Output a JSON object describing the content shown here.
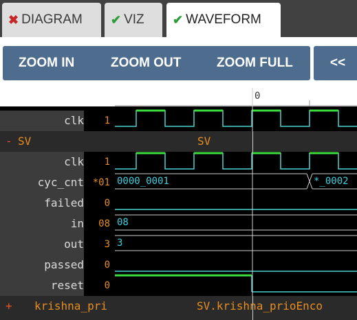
{
  "tabs": [
    {
      "label": "DIAGRAM",
      "icon": "x-icon",
      "glyph": "✖",
      "active": false
    },
    {
      "label": "VIZ",
      "icon": "check-icon",
      "glyph": "✔",
      "active": false
    },
    {
      "label": "WAVEFORM",
      "icon": "check-icon",
      "glyph": "✔",
      "active": true
    }
  ],
  "toolbar": {
    "zoom_in": "ZOOM IN",
    "zoom_out": "ZOOM OUT",
    "zoom_full": "ZOOM FULL",
    "prev": "<<"
  },
  "ruler": {
    "marker_label": "0"
  },
  "signals": {
    "top_clk": {
      "name": "clk",
      "value": "1"
    },
    "group_sv": {
      "sign": "-",
      "name": "SV",
      "center_label": "SV"
    },
    "clk": {
      "name": "clk",
      "value": "1"
    },
    "cyc_cnt": {
      "name": "cyc_cnt",
      "value": "*01",
      "bus_value_1": "0000_0001",
      "bus_value_2": "*_0002"
    },
    "failed": {
      "name": "failed",
      "value": "0"
    },
    "in": {
      "name": "in",
      "value": "08",
      "bus_value": "08"
    },
    "out": {
      "name": "out",
      "value": "3",
      "bus_value": "3"
    },
    "passed": {
      "name": "passed",
      "value": "0"
    },
    "reset": {
      "name": "reset",
      "value": "0"
    },
    "group_krishna": {
      "sign": "+",
      "name": "krishna_pri",
      "center_label": "SV.krishna_prioEnco"
    }
  },
  "colors": {
    "tab_bar": "#414141",
    "button": "#4d6c8e",
    "clock_high": "#3fdc3f",
    "trace": "#4dd4d4",
    "value_text": "#e88f1f"
  }
}
